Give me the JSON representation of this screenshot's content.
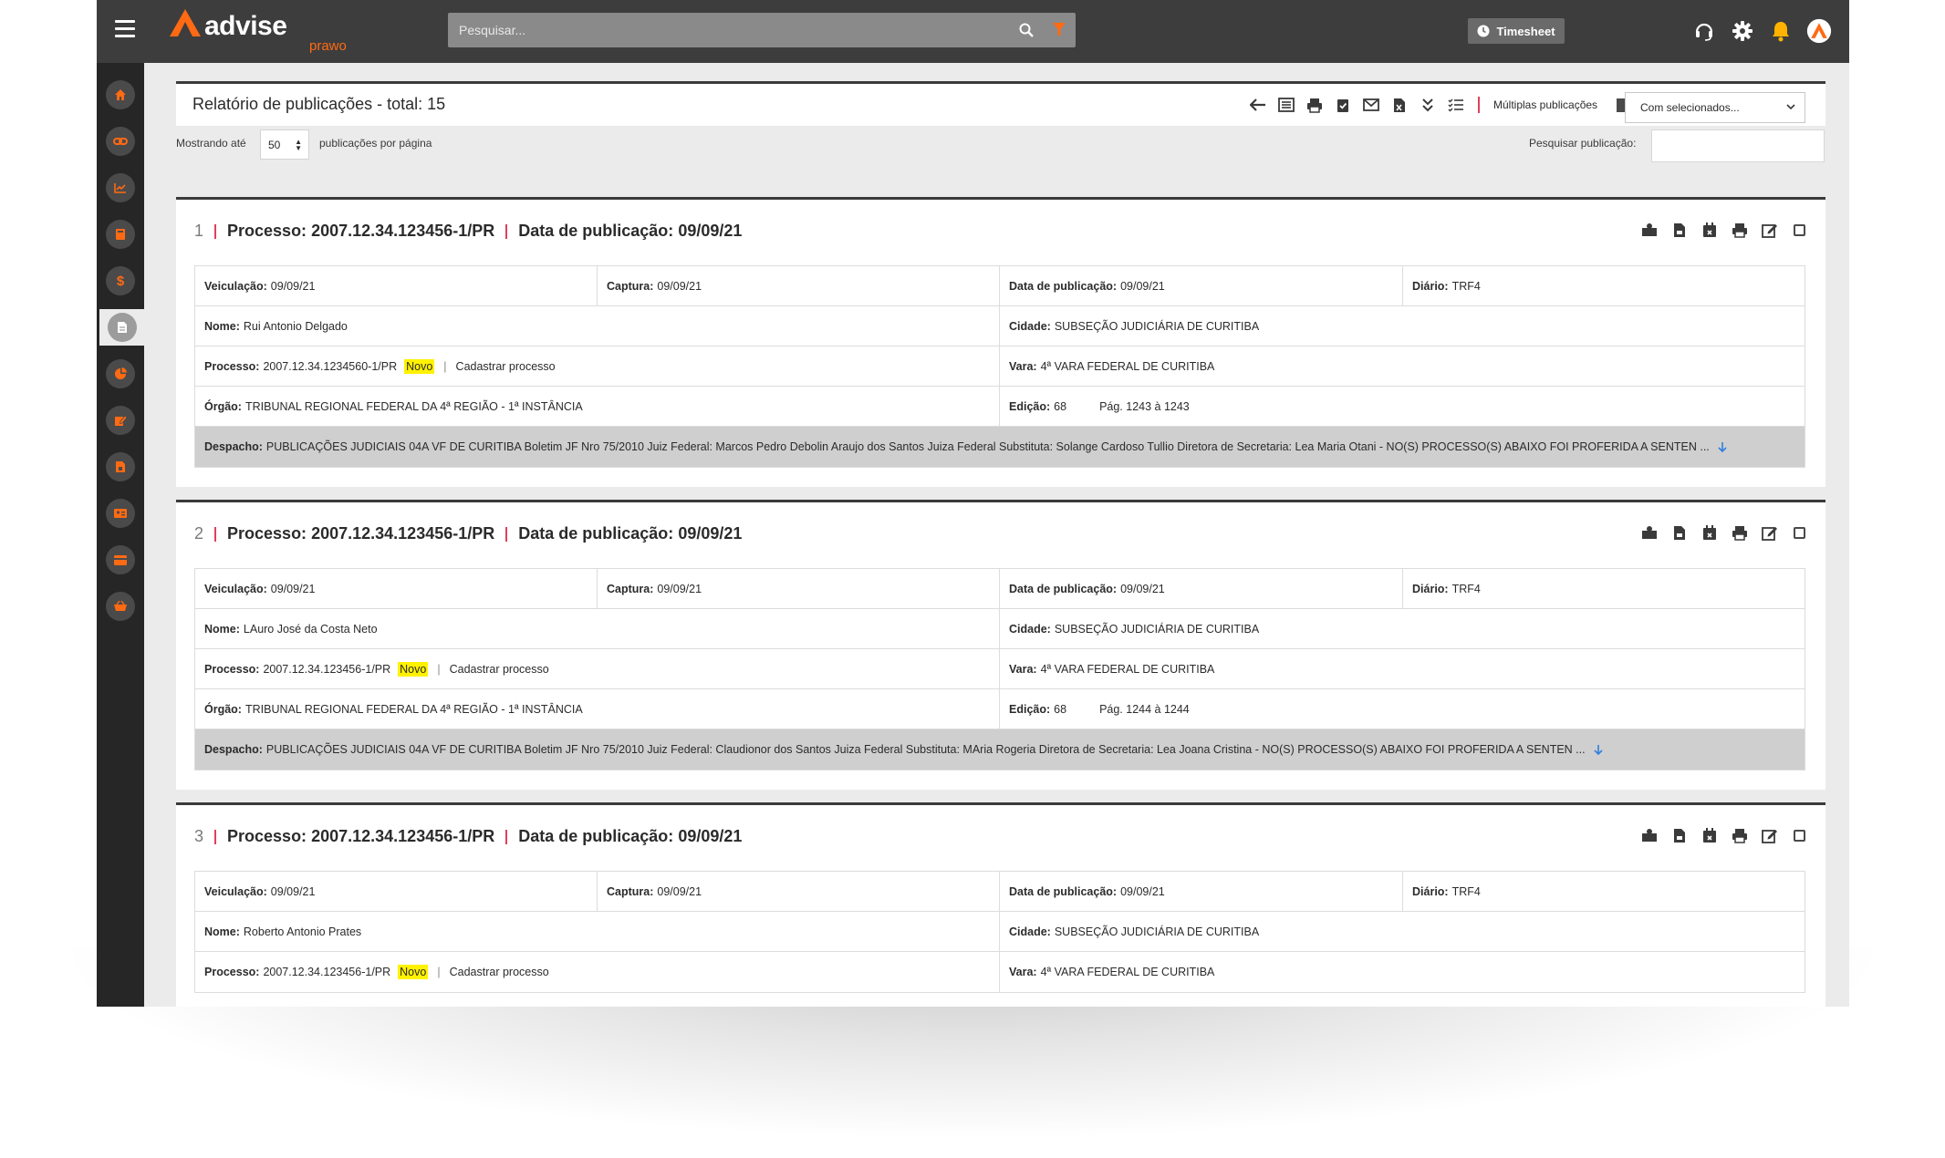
{
  "header": {
    "brand_name": "advise",
    "brand_sub": "prawo",
    "search_placeholder": "Pesquisar...",
    "timesheet_label": "Timesheet"
  },
  "colors": {
    "accent": "#ff6a13",
    "topbar": "#3d3d3d",
    "sidebar": "#262626",
    "separator": "#e0405a",
    "badge": "#fff200",
    "link_arrow": "#2f7fe0"
  },
  "report": {
    "title": "Relatório de publicações - total: 15",
    "multi_label": "Múltiplas publicações",
    "bulk_select": "Com selecionados...",
    "showing_prefix": "Mostrando até",
    "per_page_value": "50",
    "showing_suffix": "publicações por página",
    "search_label": "Pesquisar publicação:"
  },
  "labels": {
    "veiculacao": "Veiculação:",
    "captura": "Captura:",
    "data_publicacao": "Data de publicação:",
    "diario": "Diário:",
    "nome": "Nome:",
    "cidade": "Cidade:",
    "processo": "Processo:",
    "vara": "Vara:",
    "orgao": "Órgão:",
    "edicao": "Edição:",
    "despacho": "Despacho:",
    "novo": "Novo",
    "cadastrar": "Cadastrar processo",
    "pipe": "|",
    "head_processo": "Processo:",
    "head_data": "Data de publicação:"
  },
  "publications": [
    {
      "num": "1",
      "head_processo": "2007.12.34.123456-1/PR",
      "head_data": "09/09/21",
      "veiculacao": "09/09/21",
      "captura": "09/09/21",
      "data_publicacao": "09/09/21",
      "diario": "TRF4",
      "nome": "Rui Antonio Delgado",
      "cidade": "SUBSEÇÃO JUDICIÁRIA DE CURITIBA",
      "processo": "2007.12.34.1234560-1/PR",
      "vara": "4ª VARA FEDERAL DE CURITIBA",
      "orgao": "TRIBUNAL REGIONAL FEDERAL DA 4ª REGIÃO - 1ª INSTÂNCIA",
      "edicao": "68",
      "pagina": "Pág. 1243 à 1243",
      "despacho": "PUBLICAÇÕES JUDICIAIS 04A VF DE CURITIBA Boletim JF Nro 75/2010 Juiz Federal: Marcos Pedro Debolin Araujo dos Santos Juiza Federal Substituta: Solange Cardoso Tullio Diretora de Secretaria: Lea Maria Otani - NO(S) PROCESSO(S) ABAIXO FOI PROFERIDA A SENTEN ..."
    },
    {
      "num": "2",
      "head_processo": "2007.12.34.123456-1/PR",
      "head_data": "09/09/21",
      "veiculacao": "09/09/21",
      "captura": "09/09/21",
      "data_publicacao": "09/09/21",
      "diario": "TRF4",
      "nome": "LAuro José da Costa Neto",
      "cidade": "SUBSEÇÃO JUDICIÁRIA DE CURITIBA",
      "processo": "2007.12.34.123456-1/PR",
      "vara": "4ª VARA FEDERAL DE CURITIBA",
      "orgao": "TRIBUNAL REGIONAL FEDERAL DA 4ª REGIÃO - 1ª INSTÂNCIA",
      "edicao": "68",
      "pagina": "Pág. 1244 à 1244",
      "despacho": "PUBLICAÇÕES JUDICIAIS 04A VF DE CURITIBA Boletim JF Nro 75/2010 Juiz Federal: Claudionor dos Santos Juiza Federal Substituta: MAria Rogeria Diretora de Secretaria: Lea Joana Cristina - NO(S) PROCESSO(S) ABAIXO FOI PROFERIDA A SENTEN ..."
    },
    {
      "num": "3",
      "head_processo": "2007.12.34.123456-1/PR",
      "head_data": "09/09/21",
      "veiculacao": "09/09/21",
      "captura": "09/09/21",
      "data_publicacao": "09/09/21",
      "diario": "TRF4",
      "nome": "Roberto Antonio Prates",
      "cidade": "SUBSEÇÃO JUDICIÁRIA DE CURITIBA",
      "processo": "2007.12.34.123456-1/PR",
      "vara": "4ª VARA FEDERAL DE CURITIBA"
    }
  ],
  "sidebar_icons": [
    "home-icon",
    "link-icon",
    "chart-icon",
    "book-icon",
    "dollar-icon",
    "document-icon",
    "pie-chart-icon",
    "edit-icon",
    "file-icon",
    "id-card-icon",
    "card-icon",
    "basket-icon"
  ],
  "toolbar_icons": [
    "back-arrow-icon",
    "list-icon",
    "print-icon",
    "clipboard-check-icon",
    "envelope-icon",
    "excel-icon",
    "double-chevron-icon",
    "checklist-icon"
  ],
  "card_action_icons": [
    "share-icon",
    "pdf-icon",
    "calendar-icon",
    "print-icon",
    "edit-icon"
  ]
}
